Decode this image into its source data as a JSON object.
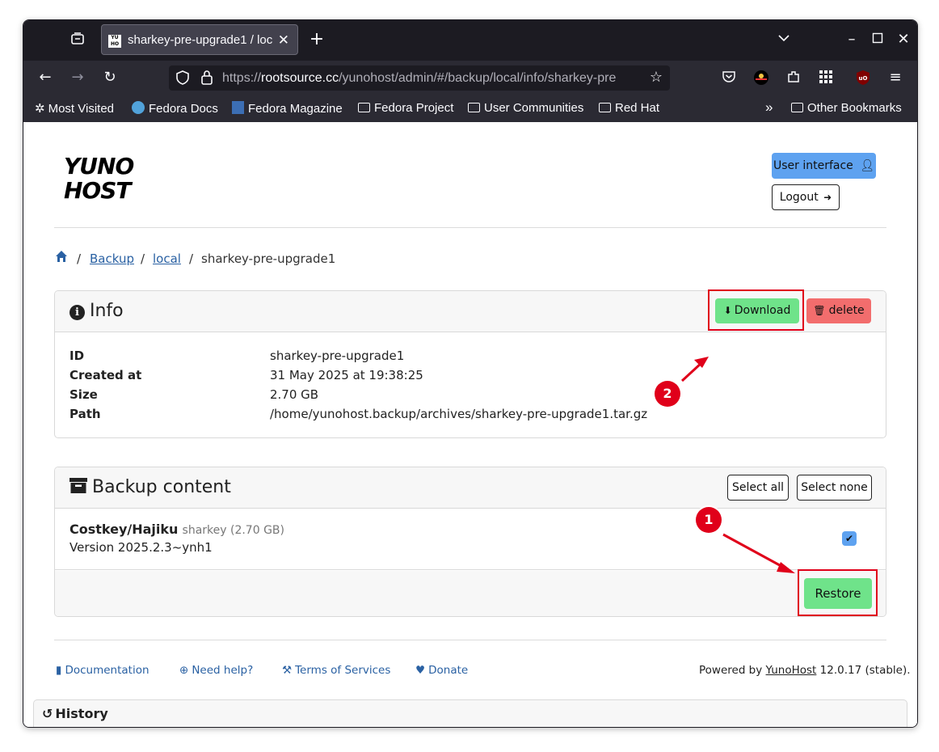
{
  "browser": {
    "tab_title": "sharkey-pre-upgrade1 / loc",
    "url_prefix": "https://",
    "url_host": "rootsource.cc",
    "url_path": "/yunohost/admin/#/backup/local/info/sharkey-pre",
    "bookmarks": [
      "Most Visited",
      "Fedora Docs",
      "Fedora Magazine",
      "Fedora Project",
      "User Communities",
      "Red Hat",
      "Other Bookmarks"
    ]
  },
  "header": {
    "logo_line1": "YUNO",
    "logo_line2": "HOST",
    "user_interface_label": "User interface",
    "logout_label": "Logout"
  },
  "breadcrumb": {
    "items": [
      "Backup",
      "local"
    ],
    "current": "sharkey-pre-upgrade1",
    "separator": "/"
  },
  "info": {
    "title": "Info",
    "download_label": "Download",
    "delete_label": "delete",
    "fields": [
      {
        "key": "ID",
        "value": "sharkey-pre-upgrade1"
      },
      {
        "key": "Created at",
        "value": "31 May 2025 at 19:38:25"
      },
      {
        "key": "Size",
        "value": "2.70 GB"
      },
      {
        "key": "Path",
        "value": "/home/yunohost.backup/archives/sharkey-pre-upgrade1.tar.gz"
      }
    ]
  },
  "backup_content": {
    "title": "Backup content",
    "select_all_label": "Select all",
    "select_none_label": "Select none",
    "app_name": "Costkey/Hajiku",
    "app_id": "sharkey (2.70 GB)",
    "app_version": "Version 2025.2.3~ynh1",
    "checked": true,
    "restore_label": "Restore"
  },
  "footer": {
    "links": [
      "Documentation",
      "Need help?",
      "Terms of Services",
      "Donate"
    ],
    "powered_prefix": "Powered by",
    "powered_link": "YunoHost",
    "powered_version": "12.0.17 (stable)."
  },
  "history": {
    "title": "History"
  },
  "annotations": {
    "step1": "1",
    "step2": "2",
    "color": "#e0001a"
  },
  "colors": {
    "primary_blue": "#5ea2f0",
    "success_green": "#6fe38a",
    "danger_red": "#f26d6d",
    "link": "#2a61a3"
  }
}
